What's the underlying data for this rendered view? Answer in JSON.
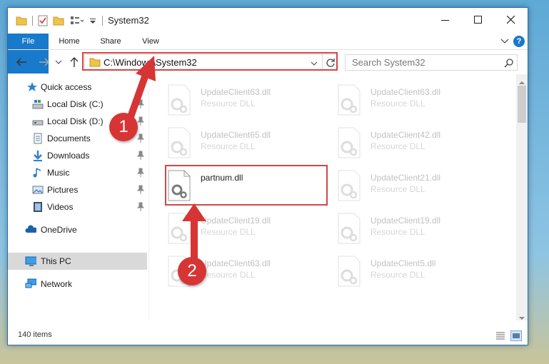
{
  "window": {
    "title": "System32"
  },
  "ribbon": {
    "tabs": [
      "File",
      "Home",
      "Share",
      "View"
    ],
    "help": "?"
  },
  "address": {
    "path": "C:\\Windows\\System32"
  },
  "search": {
    "placeholder": "Search System32"
  },
  "sidebar": {
    "items": [
      {
        "label": "Quick access",
        "icon": "star-icon",
        "pinned": false
      },
      {
        "label": "Local Disk (C:)",
        "icon": "drive-icon",
        "pinned": true
      },
      {
        "label": "Local Disk (D:)",
        "icon": "drive-icon",
        "pinned": true
      },
      {
        "label": "Documents",
        "icon": "documents-icon",
        "pinned": true
      },
      {
        "label": "Downloads",
        "icon": "downloads-icon",
        "pinned": true
      },
      {
        "label": "Music",
        "icon": "music-icon",
        "pinned": true
      },
      {
        "label": "Pictures",
        "icon": "pictures-icon",
        "pinned": true
      },
      {
        "label": "Videos",
        "icon": "videos-icon",
        "pinned": true
      },
      {
        "label": "OneDrive",
        "icon": "onedrive-icon",
        "pinned": false
      },
      {
        "label": "This PC",
        "icon": "this-pc-icon",
        "pinned": false,
        "selected": true
      },
      {
        "label": "Network",
        "icon": "network-icon",
        "pinned": false
      }
    ]
  },
  "files": [
    {
      "name": "UpdateClient63.dll",
      "type": "Resource DLL",
      "faded": true
    },
    {
      "name": "UpdateClient63.dll",
      "type": "Resource DLL",
      "faded": true
    },
    {
      "name": "UpdateClient65.dll",
      "type": "Resource DLL",
      "faded": true
    },
    {
      "name": "UpdateClient42.dll",
      "type": "Resource DLL",
      "faded": true
    },
    {
      "name": "partnum.dll",
      "type": "",
      "faded": false
    },
    {
      "name": "UpdateClient21.dll",
      "type": "Resource DLL",
      "faded": true
    },
    {
      "name": "UpdateClient19.dll",
      "type": "Resource DLL",
      "faded": true
    },
    {
      "name": "UpdateClient19.dll",
      "type": "Resource DLL",
      "faded": true
    },
    {
      "name": "UpdateClient63.dll",
      "type": "Resource DLL",
      "faded": true
    },
    {
      "name": "UpdateClient5.dll",
      "type": "Resource DLL",
      "faded": true
    }
  ],
  "status": {
    "item_count": "140 items"
  },
  "callouts": [
    "1",
    "2"
  ],
  "colors": {
    "accent": "#1979ca",
    "highlight": "#d64545"
  }
}
